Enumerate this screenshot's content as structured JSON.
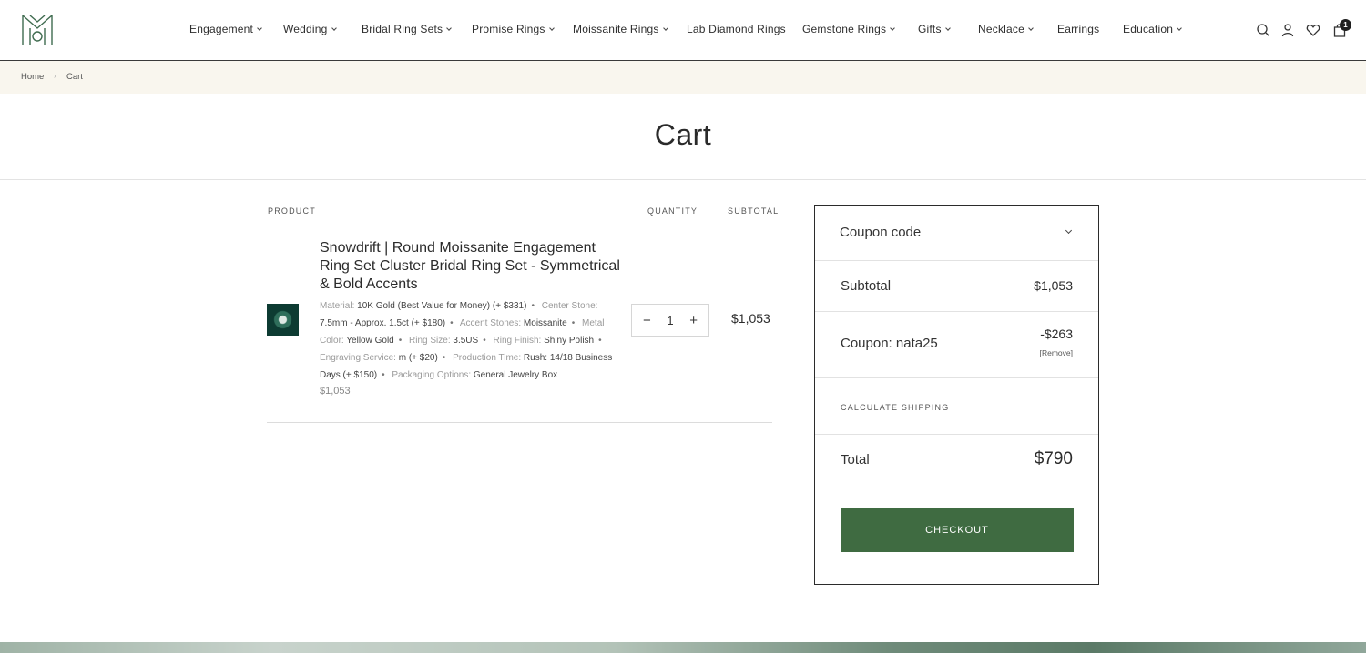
{
  "header": {
    "nav": [
      {
        "label": "Engagement",
        "dropdown": true
      },
      {
        "label": "Wedding",
        "dropdown": true
      },
      {
        "label": "Bridal Ring Sets",
        "dropdown": true
      },
      {
        "label": "Promise Rings",
        "dropdown": true
      },
      {
        "label": "Moissanite Rings",
        "dropdown": true
      },
      {
        "label": "Lab Diamond Rings",
        "dropdown": false
      },
      {
        "label": "Gemstone Rings",
        "dropdown": true
      },
      {
        "label": "Gifts",
        "dropdown": true
      },
      {
        "label": "Necklace",
        "dropdown": true
      },
      {
        "label": "Earrings",
        "dropdown": false
      },
      {
        "label": "Education",
        "dropdown": true
      }
    ],
    "cart_count": "1",
    "icons": [
      "search-icon",
      "account-icon",
      "wishlist-heart-icon",
      "cart-bag-icon"
    ]
  },
  "breadcrumb": {
    "home": "Home",
    "current": "Cart"
  },
  "page": {
    "title": "Cart"
  },
  "cart": {
    "headers": {
      "product": "PRODUCT",
      "quantity": "QUANTITY",
      "subtotal": "SUBTOTAL"
    },
    "item": {
      "title": "Snowdrift | Round Moissanite Engagement Ring Set Cluster Bridal Ring Set - Symmetrical & Bold Accents",
      "attributes": [
        {
          "label": "Material:",
          "value": "10K Gold (Best Value for Money) (+ $331)"
        },
        {
          "label": "Center Stone:",
          "value": "7.5mm - Approx. 1.5ct (+ $180)"
        },
        {
          "label": "Accent Stones:",
          "value": "Moissanite"
        },
        {
          "label": "Metal Color:",
          "value": "Yellow Gold"
        },
        {
          "label": "Ring Size:",
          "value": "3.5US"
        },
        {
          "label": "Ring Finish:",
          "value": "Shiny Polish"
        },
        {
          "label": "Engraving Service:",
          "value": "m (+ $20)"
        },
        {
          "label": "Production Time:",
          "value": "Rush: 14/18 Business Days (+ $150)"
        },
        {
          "label": "Packaging Options:",
          "value": "General Jewelry Box"
        }
      ],
      "unit_price": "$1,053",
      "quantity": "1",
      "line_subtotal": "$1,053"
    }
  },
  "summary": {
    "coupon_toggle": "Coupon code",
    "subtotal_label": "Subtotal",
    "subtotal_value": "$1,053",
    "coupon_label": "Coupon: nata25",
    "coupon_value": "-$263",
    "coupon_remove": "[Remove]",
    "shipping_label": "CALCULATE SHIPPING",
    "total_label": "Total",
    "total_value": "$790",
    "checkout_label": "CHECKOUT"
  },
  "colors": {
    "accent": "#3f6b41",
    "breadcrumb_bg": "#f9f6ee"
  }
}
